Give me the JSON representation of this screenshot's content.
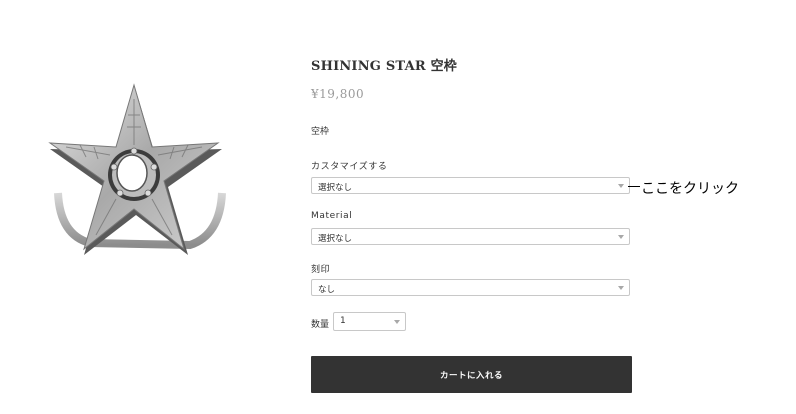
{
  "product": {
    "title": "SHINING STAR 空枠",
    "price": "¥19,800",
    "subtitle": "空枠",
    "image_alt": "star ring"
  },
  "options": [
    {
      "label": "カスタマイズする",
      "value": "選択なし"
    },
    {
      "label": "Material",
      "value": "選択なし"
    },
    {
      "label": "刻印",
      "value": "なし"
    }
  ],
  "quantity": {
    "label": "数量",
    "value": "1"
  },
  "cart_button": {
    "label": "カートに入れる"
  },
  "annotation": {
    "text": "ここをクリック"
  },
  "colors": {
    "button_bg": "#333333",
    "price": "#9a9a9a",
    "border": "#c8c8c8"
  }
}
